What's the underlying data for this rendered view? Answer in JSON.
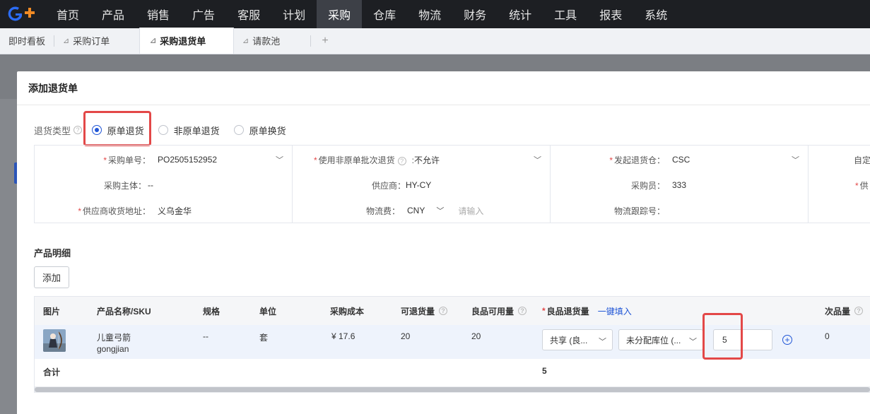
{
  "topnav": {
    "items": [
      "首页",
      "产品",
      "销售",
      "广告",
      "客服",
      "计划",
      "采购",
      "仓库",
      "物流",
      "财务",
      "统计",
      "工具",
      "报表",
      "系统"
    ],
    "active": "采购"
  },
  "tabs": {
    "items": [
      "即时看板",
      "采购订单",
      "采购退货单",
      "请款池"
    ],
    "active": "采购退货单",
    "add_icon": "+"
  },
  "modal": {
    "title": "添加退货单",
    "return_type": {
      "label": "退货类型",
      "options": [
        "原单退货",
        "非原单退货",
        "原单换货"
      ],
      "selected": "原单退货"
    },
    "form": {
      "po_label": "采购单号：",
      "po_value": "PO2505152952",
      "entity_label": "采购主体：",
      "entity_value": "--",
      "address_label": "供应商收货地址：",
      "address_value": "义乌金华",
      "batch_label": "使用非原单批次退货",
      "batch_value": "不允许",
      "supplier_label": "供应商：",
      "supplier_value": "HY-CY",
      "freight_label": "物流费：",
      "freight_currency": "CNY",
      "freight_placeholder": "请输入",
      "warehouse_label": "发起退货仓：",
      "warehouse_value": "CSC",
      "buyer_label": "采购员：",
      "buyer_value": "333",
      "tracking_label": "物流跟踪号：",
      "col4_r1": "自定",
      "col4_r2": "供"
    },
    "products": {
      "section_title": "产品明细",
      "add_button": "添加",
      "headers": {
        "image": "图片",
        "name": "产品名称/SKU",
        "spec": "规格",
        "unit": "单位",
        "cost": "采购成本",
        "returnable": "可退货量",
        "good_available": "良品可用量",
        "good_return": "良品退货量",
        "fill_all": "一键填入",
        "defective": "次品量"
      },
      "row": {
        "name": "儿童弓箭",
        "sku": "gongjian",
        "spec": "--",
        "unit": "套",
        "cost": "¥ 17.6",
        "returnable": "20",
        "good_available": "20",
        "share_select": "共享 (良...",
        "location_select": "未分配库位 (...",
        "return_qty": "5",
        "defective": "0"
      },
      "footer": {
        "label": "合计",
        "total": "5"
      }
    }
  },
  "colors": {
    "accent": "#1f55d6",
    "highlight": "#e34848",
    "nav_bg": "#1d1f23"
  }
}
